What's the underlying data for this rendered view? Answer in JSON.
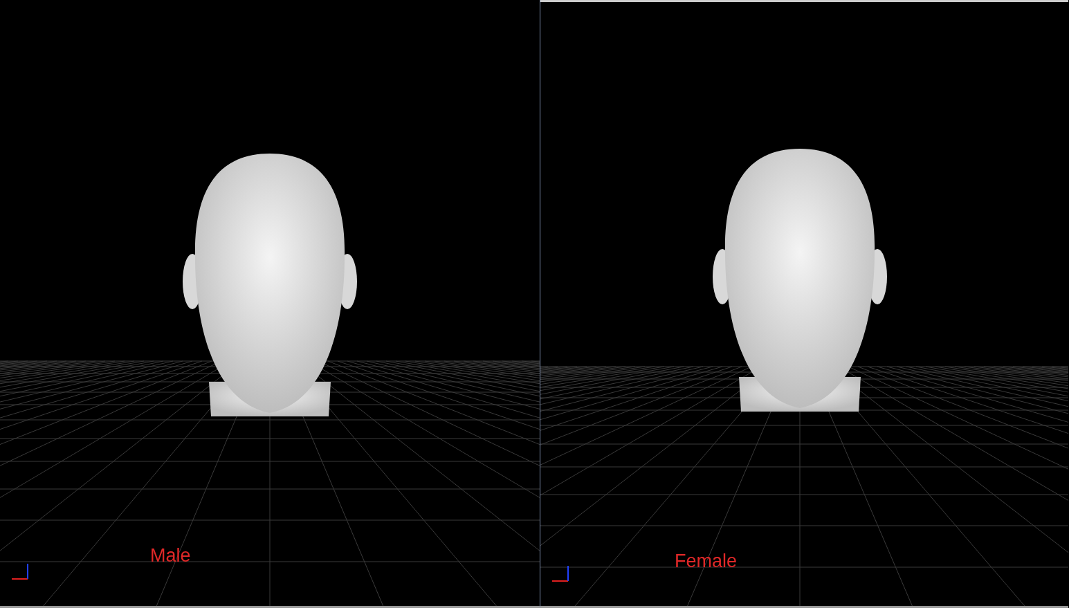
{
  "viewports": [
    {
      "label": "Male"
    },
    {
      "label": "Female"
    }
  ]
}
